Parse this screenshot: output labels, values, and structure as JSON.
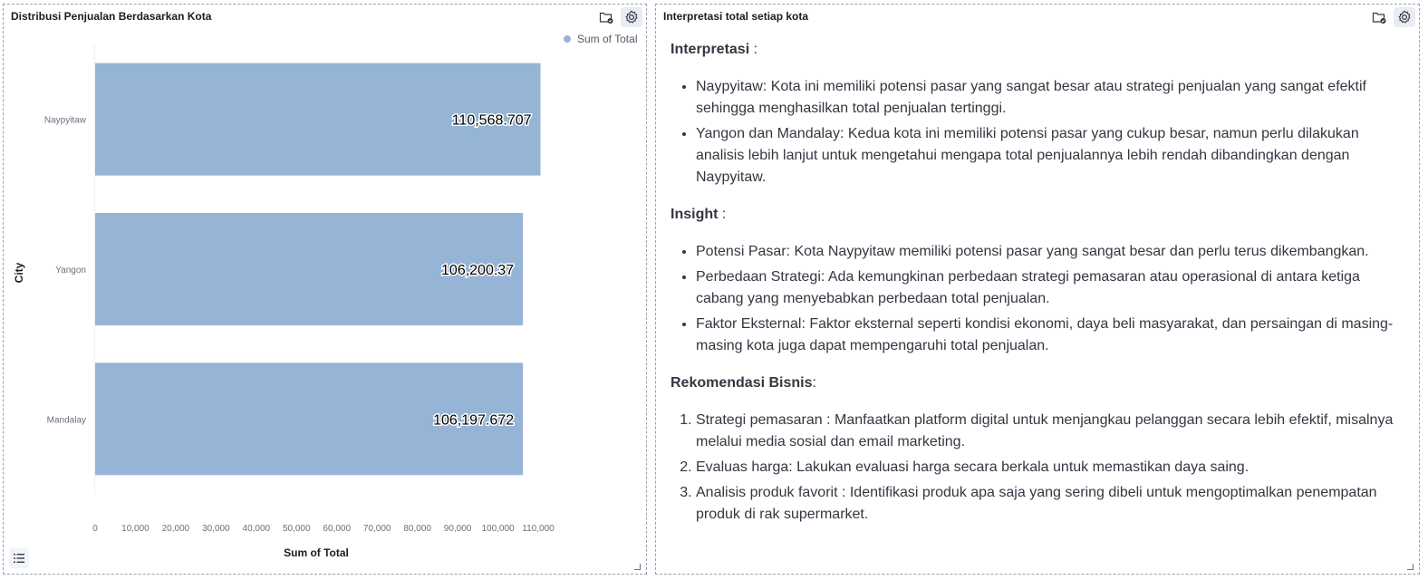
{
  "left_panel": {
    "title": "Distribusi Penjualan Berdasarkan Kota"
  },
  "right_panel": {
    "title": "Interpretasi total setiap kota",
    "sections": {
      "interpretasi": {
        "heading": "Interpretasi",
        "suffix": " :",
        "items": [
          "Naypyitaw: Kota ini memiliki potensi pasar yang sangat besar atau strategi penjualan yang sangat efektif sehingga menghasilkan total penjualan tertinggi.",
          "Yangon dan Mandalay: Kedua kota ini memiliki potensi pasar yang cukup besar, namun perlu dilakukan analisis lebih lanjut untuk mengetahui mengapa total penjualannya lebih rendah dibandingkan dengan Naypyitaw."
        ]
      },
      "insight": {
        "heading": "Insight",
        "suffix": " :",
        "items": [
          "Potensi Pasar: Kota Naypyitaw memiliki potensi pasar yang sangat besar dan perlu terus dikembangkan.",
          "Perbedaan Strategi: Ada kemungkinan perbedaan strategi pemasaran atau operasional di antara ketiga cabang yang menyebabkan perbedaan total penjualan.",
          "Faktor Eksternal: Faktor eksternal seperti kondisi ekonomi, daya beli masyarakat, dan persaingan di masing-masing kota juga dapat mempengaruhi total penjualan."
        ]
      },
      "rekomendasi": {
        "heading": "Rekomendasi Bisnis",
        "suffix": ":",
        "items": [
          "Strategi pemasaran : Manfaatkan platform digital untuk menjangkau pelanggan secara lebih efektif, misalnya melalui media sosial dan email marketing.",
          "Evaluas harga: Lakukan evaluasi harga secara berkala untuk memastikan daya saing.",
          "Analisis produk favorit : Identifikasi produk apa saja yang sering dibeli untuk mengoptimalkan penempatan produk di rak supermarket."
        ]
      }
    }
  },
  "colors": {
    "bar": "#96b5d6",
    "legend_dot": "#96b5d6"
  },
  "icons": [
    "folder-check-icon",
    "gear-icon",
    "list-icon"
  ],
  "chart_data": {
    "type": "bar",
    "orientation": "horizontal",
    "categories": [
      "Naypyitaw",
      "Yangon",
      "Mandalay"
    ],
    "values": [
      110568.707,
      106200.37,
      106197.672
    ],
    "value_labels": [
      "110,568.707",
      "106,200.37",
      "106,197.672"
    ],
    "series": [
      {
        "name": "Sum of Total",
        "values": [
          110568.707,
          106200.37,
          106197.672
        ]
      }
    ],
    "xlabel": "Sum of Total",
    "ylabel": "City",
    "xlim": [
      0,
      110000
    ],
    "ticks": [
      "0",
      "10,000",
      "20,000",
      "30,000",
      "40,000",
      "50,000",
      "60,000",
      "70,000",
      "80,000",
      "90,000",
      "100,000",
      "110,000"
    ],
    "legend": "top-right",
    "grid": false
  }
}
